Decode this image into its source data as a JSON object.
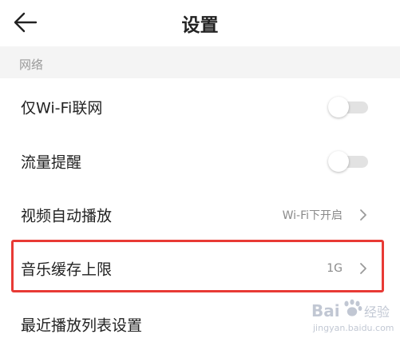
{
  "header": {
    "title": "设置",
    "back_icon": "arrow-left-icon"
  },
  "section": {
    "label": "网络"
  },
  "rows": [
    {
      "label": "仅Wi-Fi联网",
      "control": "toggle",
      "on": false
    },
    {
      "label": "流量提醒",
      "control": "toggle",
      "on": false
    },
    {
      "label": "视频自动播放",
      "value": "Wi-Fi下开启",
      "control": "chevron"
    },
    {
      "label": "音乐缓存上限",
      "value": "1G",
      "control": "chevron"
    },
    {
      "label": "最近播放列表设置"
    }
  ],
  "watermark": {
    "brand": "Bai",
    "brand_suffix": "经验",
    "url": "jingyan.baidu.com"
  },
  "colors": {
    "highlight": "#e83a35",
    "section_bg": "#f4f4f4",
    "toggle_track": "#e2e2e2",
    "muted_text": "#8a8a8a"
  }
}
